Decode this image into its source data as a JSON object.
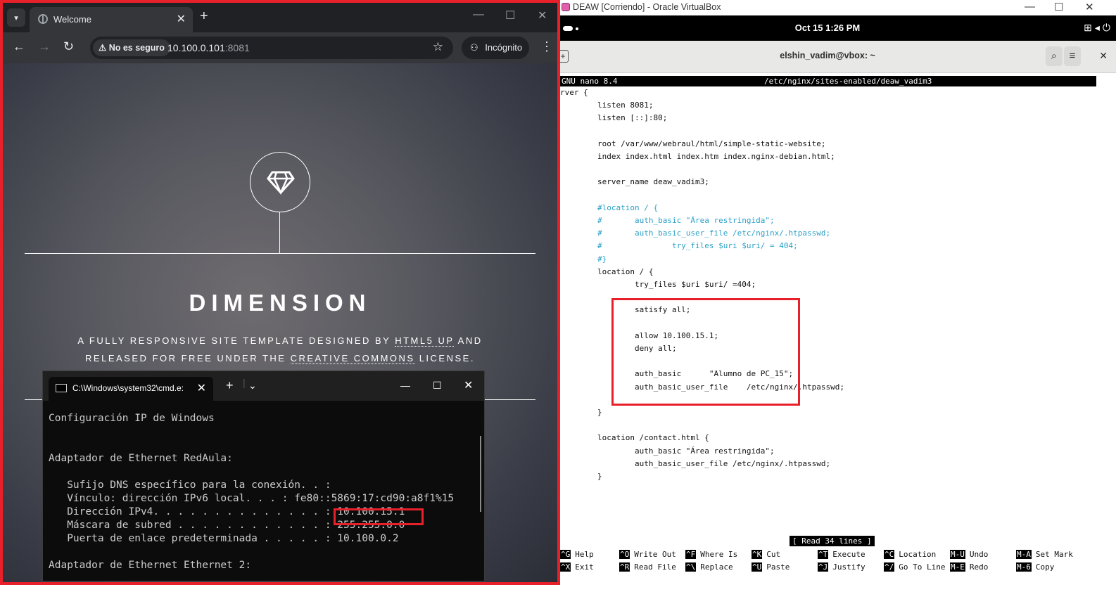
{
  "chrome": {
    "tab_title": "Welcome",
    "security_label": "No es seguro",
    "url_host": "10.100.0.101",
    "url_port": ":8081",
    "incognito_label": "Incógnito"
  },
  "site": {
    "title": "DIMENSION",
    "sub_pre": "A FULLY RESPONSIVE SITE TEMPLATE DESIGNED BY ",
    "sub_link1": "HTML5 UP",
    "sub_mid": " AND RELEASED FOR FREE UNDER THE ",
    "sub_link2": "CREATIVE COMMONS",
    "sub_post": " LICENSE."
  },
  "cmd": {
    "tab_title": "C:\\Windows\\system32\\cmd.e:",
    "lines": [
      "Configuración IP de Windows",
      "",
      "",
      "Adaptador de Ethernet RedAula:",
      "",
      "   Sufijo DNS específico para la conexión. . :",
      "   Vínculo: dirección IPv6 local. . . : fe80::5869:17:cd90:a8f1%15",
      "   Dirección IPv4. . . . . . . . . . . . . . : 10.100.15.1",
      "   Máscara de subred . . . . . . . . . . . . : 255.255.0.0",
      "   Puerta de enlace predeterminada . . . . . : 10.100.0.2",
      "",
      "Adaptador de Ethernet Ethernet 2:"
    ]
  },
  "vbox": {
    "window_title": "DEAW [Corriendo] - Oracle VirtualBox",
    "clock": "Oct 15   1:26 PM",
    "terminal_title": "elshin_vadim@vbox: ~",
    "nano_version": "GNU nano 8.4",
    "file_path": "/etc/nginx/sites-enabled/deaw_vadim3",
    "status": "[ Read 34 lines ]",
    "code": [
      {
        "t": "rver {",
        "c": false
      },
      {
        "t": "        listen 8081;",
        "c": false
      },
      {
        "t": "        listen [::]:80;",
        "c": false
      },
      {
        "t": "",
        "c": false
      },
      {
        "t": "        root /var/www/webraul/html/simple-static-website;",
        "c": false
      },
      {
        "t": "        index index.html index.htm index.nginx-debian.html;",
        "c": false
      },
      {
        "t": "",
        "c": false
      },
      {
        "t": "        server_name deaw_vadim3;",
        "c": false
      },
      {
        "t": "",
        "c": false
      },
      {
        "t": "        #location / {",
        "c": true
      },
      {
        "t": "        #       auth_basic \"Área restringida\";",
        "c": true
      },
      {
        "t": "        #       auth_basic_user_file /etc/nginx/.htpasswd;",
        "c": true
      },
      {
        "t": "        #               try_files $uri $uri/ = 404;",
        "c": true
      },
      {
        "t": "        #}",
        "c": true
      },
      {
        "t": "        location / {",
        "c": false
      },
      {
        "t": "                try_files $uri $uri/ =404;",
        "c": false
      },
      {
        "t": "",
        "c": false
      },
      {
        "t": "                satisfy all;",
        "c": false
      },
      {
        "t": "",
        "c": false
      },
      {
        "t": "                allow 10.100.15.1;",
        "c": false
      },
      {
        "t": "                deny all;",
        "c": false
      },
      {
        "t": "",
        "c": false
      },
      {
        "t": "                auth_basic      \"Alumno de PC_15\";",
        "c": false
      },
      {
        "t": "                auth_basic_user_file    /etc/nginx/.htpasswd;",
        "c": false
      },
      {
        "t": "",
        "c": false
      },
      {
        "t": "        }",
        "c": false
      },
      {
        "t": "",
        "c": false
      },
      {
        "t": "        location /contact.html {",
        "c": false
      },
      {
        "t": "                auth_basic \"Área restringida\";",
        "c": false
      },
      {
        "t": "                auth_basic_user_file /etc/nginx/.htpasswd;",
        "c": false
      },
      {
        "t": "        }",
        "c": false
      }
    ],
    "shortcuts_row1": [
      {
        "k": "^G",
        "l": "Help"
      },
      {
        "k": "^O",
        "l": "Write Out"
      },
      {
        "k": "^F",
        "l": "Where Is"
      },
      {
        "k": "^K",
        "l": "Cut"
      },
      {
        "k": "^T",
        "l": "Execute"
      },
      {
        "k": "^C",
        "l": "Location"
      },
      {
        "k": "M-U",
        "l": "Undo"
      },
      {
        "k": "M-A",
        "l": "Set Mark"
      }
    ],
    "shortcuts_row2": [
      {
        "k": "^X",
        "l": "Exit"
      },
      {
        "k": "^R",
        "l": "Read File"
      },
      {
        "k": "^\\",
        "l": "Replace"
      },
      {
        "k": "^U",
        "l": "Paste"
      },
      {
        "k": "^J",
        "l": "Justify"
      },
      {
        "k": "^/",
        "l": "Go To Line"
      },
      {
        "k": "M-E",
        "l": "Redo"
      },
      {
        "k": "M-6",
        "l": "Copy"
      }
    ]
  },
  "colors": {
    "highlight": "#e8202a",
    "comment": "#2aa0c8",
    "chrome_bg": "#202124"
  }
}
